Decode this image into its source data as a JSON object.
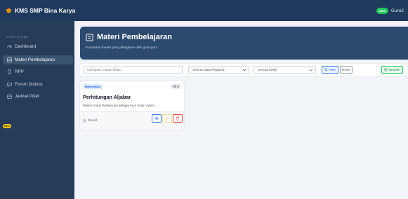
{
  "app": {
    "title": "KMS SMP Bina Karya"
  },
  "user": {
    "role_badge": "Guru",
    "name": "Guru2"
  },
  "sidebar": {
    "menu_heading": "MENU UTAMA",
    "items": [
      {
        "label": "Dashboard",
        "icon": "dashboard-icon"
      },
      {
        "label": "Materi Pembelajaran",
        "icon": "document-icon"
      },
      {
        "label": "RPP",
        "icon": "file-icon"
      },
      {
        "label": "Forum Diskusi",
        "icon": "chat-icon"
      },
      {
        "label": "Jadwal Piket",
        "icon": "calendar-icon"
      }
    ],
    "new_badge": "Baru"
  },
  "header": {
    "title": "Materi Pembelajaran",
    "subtitle": "Kumpulan materi yang dibagikan oleh guru-guru"
  },
  "filters": {
    "search_placeholder": "Cari judul, mapel, kelas...",
    "subject_select": "Semua Mata Pelajaran",
    "class_select": "Semua Kelas",
    "filter_label": "Filter",
    "reset_label": "Reset",
    "add_label": "Tambah"
  },
  "cards": [
    {
      "subject": "Matematika",
      "class": "VII A",
      "title": "Perhitungan Aljabar",
      "description": "Materi Untuk Pertemuan Minggu ke-4 bulan maret",
      "author": "Guru2"
    }
  ],
  "colors": {
    "topbar": "#1f3a5c",
    "sidebar": "#263c57",
    "banner": "#2d4a6e",
    "accent_blue": "#2563eb",
    "accent_green": "#22c55e",
    "danger": "#ef4444",
    "brand_icon": "#f59e0b"
  }
}
